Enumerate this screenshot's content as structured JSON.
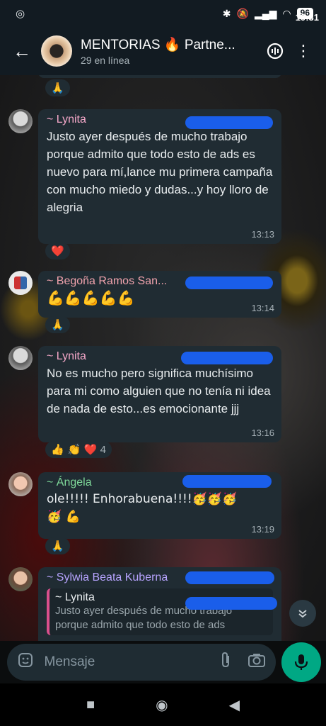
{
  "status_bar": {
    "time": "19:31",
    "battery": "96"
  },
  "header": {
    "title": "MENTORIAS 🔥 Partne...",
    "subtitle": "29 en línea"
  },
  "messages": [
    {
      "sender": "~ Lynita",
      "sender_color": "#f5a8c9",
      "text": "Justo ayer después de mucho trabajo porque admito que todo esto de ads es nuevo para mí,lance mu primera campaña con mucho miedo y dudas...y hoy lloro de alegria",
      "time": "13:13",
      "reaction": "❤️"
    },
    {
      "sender": "~ Begoña Ramos San...",
      "sender_color": "#f1a3ad",
      "text": "💪💪💪💪💪",
      "time": "13:14",
      "reaction": "🙏"
    },
    {
      "sender": "~ Lynita",
      "sender_color": "#f5a8c9",
      "text": "No es mucho pero significa muchísimo para mi como alguien que no tenía ni idea de nada de esto...es emocionante jjj",
      "time": "13:16",
      "reaction": "👍 👏 ❤️",
      "reaction_count": "4"
    },
    {
      "sender": "~ Ángela",
      "sender_color": "#7fd99a",
      "text": "ole!!!!! Enhorabuena!!!!🥳🥳🥳🥳 💪",
      "time": "13:19",
      "reaction": "🙏"
    },
    {
      "sender": "~ Sylwia Beata Kuberna",
      "sender_color": "#b7a4ff",
      "reply_sender": "~ Lynita",
      "reply_text": "Justo ayer después de mucho trabajo porque admito que todo esto de ads"
    }
  ],
  "top_reaction": "🙏",
  "input": {
    "placeholder": "Mensaje"
  },
  "colors": {
    "accent": "#00a884",
    "bubble": "#202c33",
    "header": "#121b22",
    "redaction": "#1a5eea"
  },
  "icons": [
    "whatsapp-icon",
    "bluetooth-icon",
    "mute-icon",
    "signal-icon",
    "wifi-icon",
    "back-arrow-icon",
    "voice-chat-icon",
    "more-options-icon",
    "sticker-icon",
    "attach-icon",
    "camera-icon",
    "mic-icon",
    "scroll-down-icon",
    "nav-recents-icon",
    "nav-home-icon",
    "nav-back-icon"
  ]
}
